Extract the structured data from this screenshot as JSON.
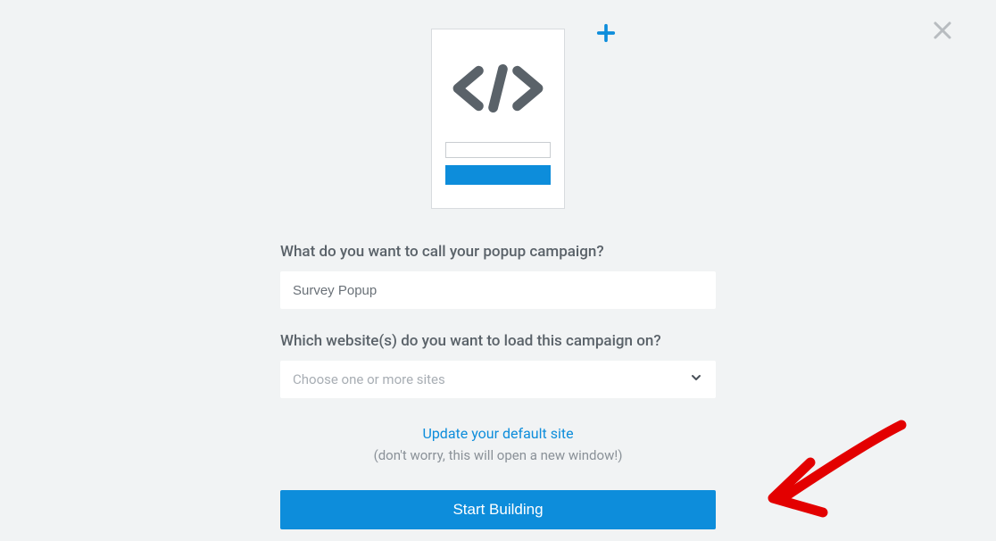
{
  "labels": {
    "campaign_name": "What do you want to call your popup campaign?",
    "websites": "Which website(s) do you want to load this campaign on?"
  },
  "inputs": {
    "campaign_name_value": "Survey Popup",
    "websites_placeholder": "Choose one or more sites"
  },
  "links": {
    "default_site": "Update your default site"
  },
  "hints": {
    "new_window": "(don't worry, this will open a new window!)"
  },
  "buttons": {
    "start_building": "Start Building"
  },
  "colors": {
    "primary": "#0d8ddb",
    "annotation": "#e30000"
  }
}
